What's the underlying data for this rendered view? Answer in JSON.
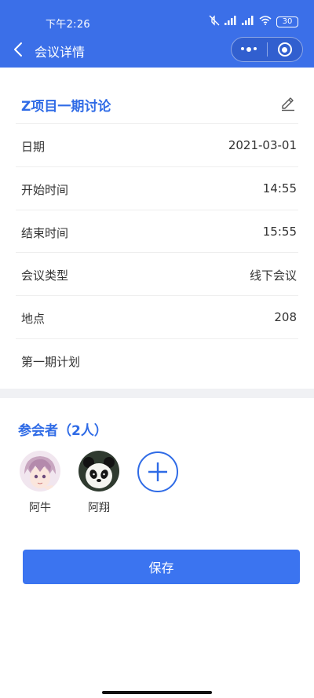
{
  "status_bar": {
    "time": "下午2:26",
    "battery": "30",
    "icons": [
      "mute-icon",
      "signal-icon",
      "hd-signal-icon",
      "wifi-icon",
      "battery-icon"
    ]
  },
  "nav": {
    "title": "会议详情",
    "accent": "#3b6fe8"
  },
  "meeting": {
    "title": "Z项目一期讨论",
    "rows": [
      {
        "label": "日期",
        "value": "2021-03-01"
      },
      {
        "label": "开始时间",
        "value": "14:55"
      },
      {
        "label": "结束时间",
        "value": "15:55"
      },
      {
        "label": "会议类型",
        "value": "线下会议"
      },
      {
        "label": "地点",
        "value": "208"
      },
      {
        "label": "第一期计划",
        "value": ""
      }
    ]
  },
  "participants": {
    "title": "参会者（2人）",
    "people": [
      {
        "name": "阿牛",
        "avatar": "anime-boy-avatar"
      },
      {
        "name": "阿翔",
        "avatar": "panda-avatar"
      }
    ]
  },
  "actions": {
    "save_label": "保存"
  },
  "colors": {
    "primary": "#2f6be6",
    "button": "#3b74f0",
    "divider": "#f0f1f4"
  }
}
